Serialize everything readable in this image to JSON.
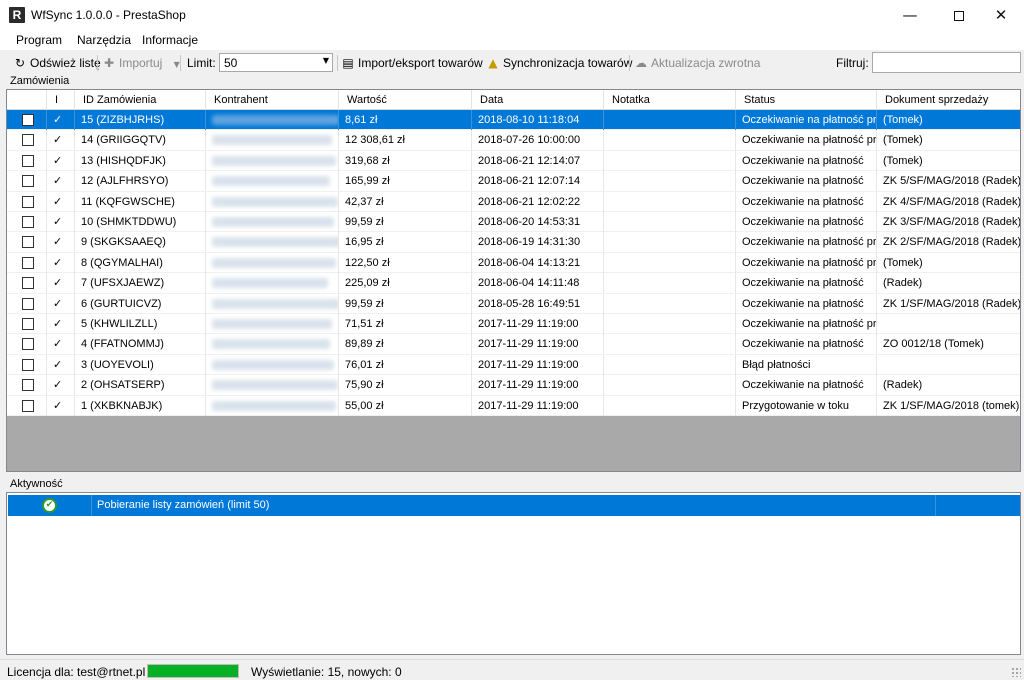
{
  "window": {
    "app_icon": "R",
    "title": "WfSync 1.0.0.0 - PrestaShop"
  },
  "menu": [
    "Program",
    "Narzędzia",
    "Informacje"
  ],
  "toolbar": {
    "refresh_label": "Odśwież listę",
    "refresh_icon": "refresh-icon",
    "import_label": "Importuj",
    "import_icon": "plus-icon",
    "limit_label": "Limit:",
    "limit_value": "50",
    "import_export_label": "Import/eksport towarów",
    "sync_label": "Synchronizacja towarów",
    "reverse_update_label": "Aktualizacja zwrotna",
    "filter_label": "Filtruj:",
    "filter_value": ""
  },
  "orders": {
    "group_label": "Zamówienia",
    "columns": [
      "",
      "I",
      "ID Zamówienia",
      "Kontrahent",
      "Wartość",
      "Data",
      "Notatka",
      "Status",
      "Dokument sprzedaży"
    ],
    "rows": [
      {
        "id": "15 (ZIZBHJRHS)",
        "value": "8,61 zł",
        "date": "2018-08-10 11:18:04",
        "note": "",
        "status": "Oczekiwanie na płatność pr...",
        "doc": "(Tomek)",
        "selected": true
      },
      {
        "id": "14 (GRIIGGQTV)",
        "value": "12 308,61 zł",
        "date": "2018-07-26 10:00:00",
        "note": "",
        "status": "Oczekiwanie na płatność pr...",
        "doc": "(Tomek)"
      },
      {
        "id": "13 (HISHQDFJK)",
        "value": "319,68 zł",
        "date": "2018-06-21 12:14:07",
        "note": "",
        "status": "Oczekiwanie na płatność",
        "doc": "(Tomek)"
      },
      {
        "id": "12 (AJLFHRSYO)",
        "value": "165,99 zł",
        "date": "2018-06-21 12:07:14",
        "note": "",
        "status": "Oczekiwanie na płatność",
        "doc": "ZK 5/SF/MAG/2018 (Radek)"
      },
      {
        "id": "11 (KQFGWSCHE)",
        "value": "42,37 zł",
        "date": "2018-06-21 12:02:22",
        "note": "",
        "status": "Oczekiwanie na płatność",
        "doc": "ZK 4/SF/MAG/2018 (Radek)"
      },
      {
        "id": "10 (SHMKTDDWU)",
        "value": "99,59 zł",
        "date": "2018-06-20 14:53:31",
        "note": "",
        "status": "Oczekiwanie na płatność",
        "doc": "ZK 3/SF/MAG/2018 (Radek)"
      },
      {
        "id": "9 (SKGKSAAEQ)",
        "value": "16,95 zł",
        "date": "2018-06-19 14:31:30",
        "note": "",
        "status": "Oczekiwanie na płatność pr...",
        "doc": "ZK 2/SF/MAG/2018 (Radek)"
      },
      {
        "id": "8 (QGYMALHAI)",
        "value": "122,50 zł",
        "date": "2018-06-04 14:13:21",
        "note": "",
        "status": "Oczekiwanie na płatność pr...",
        "doc": "(Tomek)"
      },
      {
        "id": "7 (UFSXJAEWZ)",
        "value": "225,09 zł",
        "date": "2018-06-04 14:11:48",
        "note": "",
        "status": "Oczekiwanie na płatność",
        "doc": "(Radek)"
      },
      {
        "id": "6 (GURTUICVZ)",
        "value": "99,59 zł",
        "date": "2018-05-28 16:49:51",
        "note": "",
        "status": "Oczekiwanie na płatność",
        "doc": "ZK 1/SF/MAG/2018 (Radek)"
      },
      {
        "id": "5 (KHWLILZLL)",
        "value": "71,51 zł",
        "date": "2017-11-29 11:19:00",
        "note": "",
        "status": "Oczekiwanie na płatność pr...",
        "doc": ""
      },
      {
        "id": "4 (FFATNOMMJ)",
        "value": "89,89 zł",
        "date": "2017-11-29 11:19:00",
        "note": "",
        "status": "Oczekiwanie na płatność",
        "doc": "ZO 0012/18 (Tomek)"
      },
      {
        "id": "3 (UOYEVOLI)",
        "value": "76,01 zł",
        "date": "2017-11-29 11:19:00",
        "note": "",
        "status": "Błąd płatności",
        "doc": ""
      },
      {
        "id": "2 (OHSATSERP)",
        "value": "75,90 zł",
        "date": "2017-11-29 11:19:00",
        "note": "",
        "status": "Oczekiwanie na płatność",
        "doc": "(Radek)"
      },
      {
        "id": "1 (XKBKNABJK)",
        "value": "55,00 zł",
        "date": "2017-11-29 11:19:00",
        "note": "",
        "status": "Przygotowanie w toku",
        "doc": "ZK 1/SF/MAG/2018 (tomek)"
      }
    ],
    "imported_mark": "✓"
  },
  "activity": {
    "group_label": "Aktywność",
    "items": [
      {
        "icon": "check-circle-icon",
        "text": "Pobieranie listy zamówień (limit 50)"
      }
    ]
  },
  "status": {
    "license": "Licencja dla: test@rtnet.pl",
    "progress": 1.0,
    "display": "Wyświetlanie: 15, nowych: 0"
  },
  "colors": {
    "selection": "#0078d7",
    "progress": "#06b025",
    "grid_background": "#a9a9a9"
  }
}
